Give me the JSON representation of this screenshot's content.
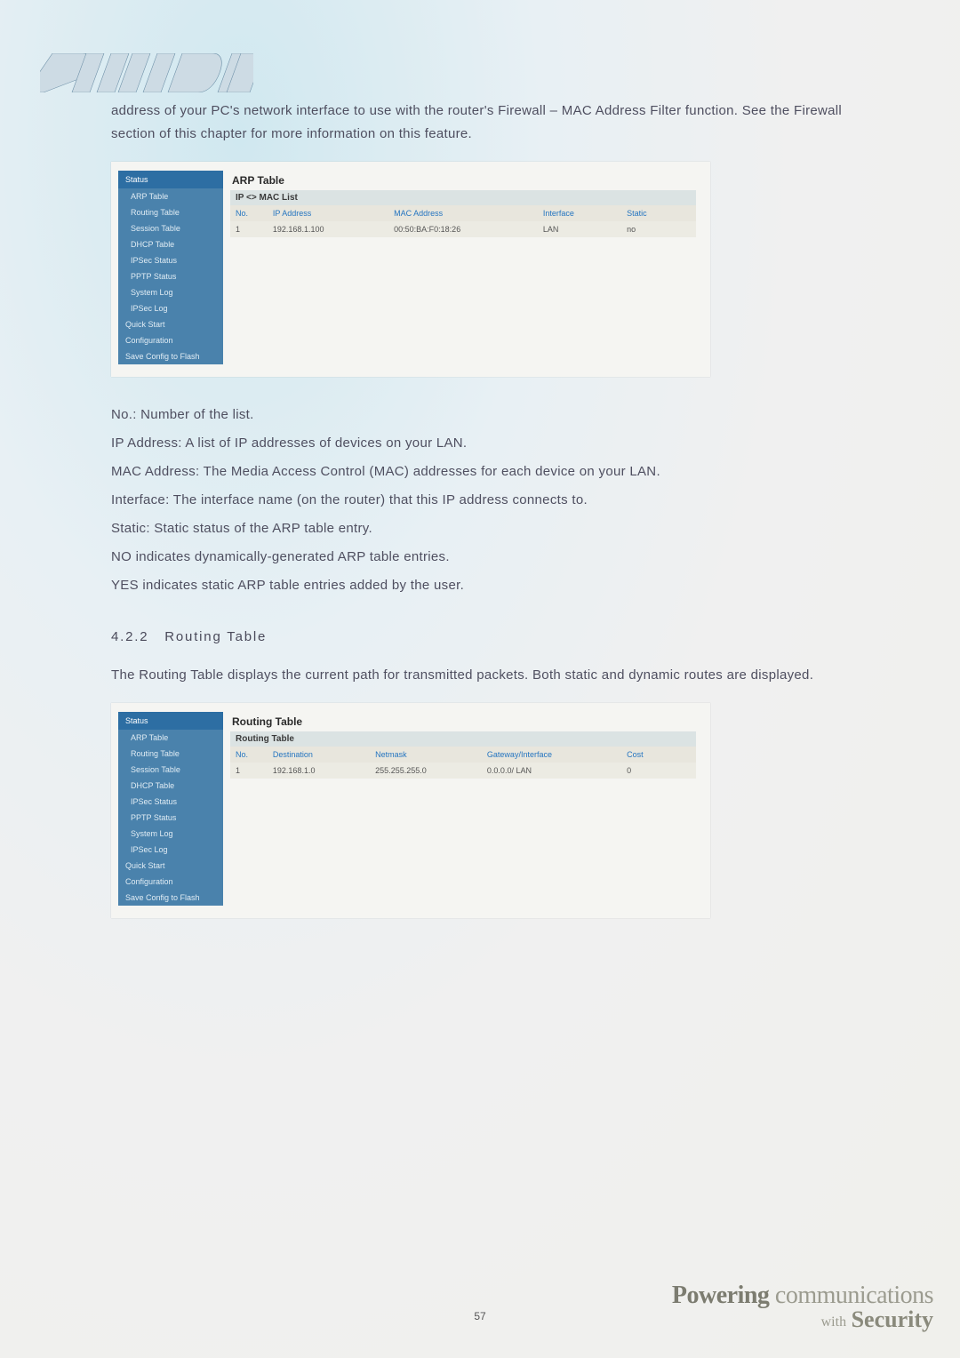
{
  "intro": "address of your PC's network interface to use with the router's Firewall – MAC Address Filter function. See the Firewall section of this chapter for more information on this feature.",
  "screenshot_arp": {
    "sidebar": {
      "header": "Status",
      "items": [
        "ARP Table",
        "Routing Table",
        "Session Table",
        "DHCP Table",
        "IPSec Status",
        "PPTP Status",
        "System Log",
        "IPSec Log"
      ],
      "bottom": [
        "Quick Start",
        "Configuration",
        "Save Config to Flash"
      ]
    },
    "panel_title": "ARP Table",
    "panel_sub": "IP <> MAC List",
    "columns": [
      "No.",
      "IP Address",
      "MAC Address",
      "Interface",
      "Static"
    ],
    "row": {
      "no": "1",
      "ip": "192.168.1.100",
      "mac": "00:50:BA:F0:18:26",
      "iface": "LAN",
      "static": "no"
    }
  },
  "defs": {
    "no": "No.: Number of the list.",
    "ip": "IP Address: A list of IP addresses of devices on your LAN.",
    "mac": "MAC Address: The Media Access Control (MAC) addresses for each device on your LAN.",
    "iface": "Interface: The interface name (on the router) that this IP address connects to.",
    "static": "Static: Static status of the ARP table entry.",
    "no_line": "NO indicates dynamically-generated ARP table entries.",
    "yes_line": "YES indicates static ARP table entries added by the user."
  },
  "section_num": "4.2.2",
  "section_title": "Routing Table",
  "routing_intro": "The Routing Table displays the current path for transmitted packets. Both static and dynamic routes are displayed.",
  "screenshot_routing": {
    "sidebar": {
      "header": "Status",
      "items": [
        "ARP Table",
        "Routing Table",
        "Session Table",
        "DHCP Table",
        "IPSec Status",
        "PPTP Status",
        "System Log",
        "IPSec Log"
      ],
      "bottom": [
        "Quick Start",
        "Configuration",
        "Save Config to Flash"
      ]
    },
    "panel_title": "Routing Table",
    "panel_sub": "Routing Table",
    "columns": [
      "No.",
      "Destination",
      "Netmask",
      "Gateway/Interface",
      "Cost"
    ],
    "row": {
      "no": "1",
      "dest": "192.168.1.0",
      "mask": "255.255.255.0",
      "gw": "0.0.0.0/ LAN",
      "cost": "0"
    }
  },
  "page_number": "57",
  "tagline": {
    "top_bold": "Powering",
    "top_light": "communications",
    "sub_small": "with",
    "sub_big": "Security"
  }
}
